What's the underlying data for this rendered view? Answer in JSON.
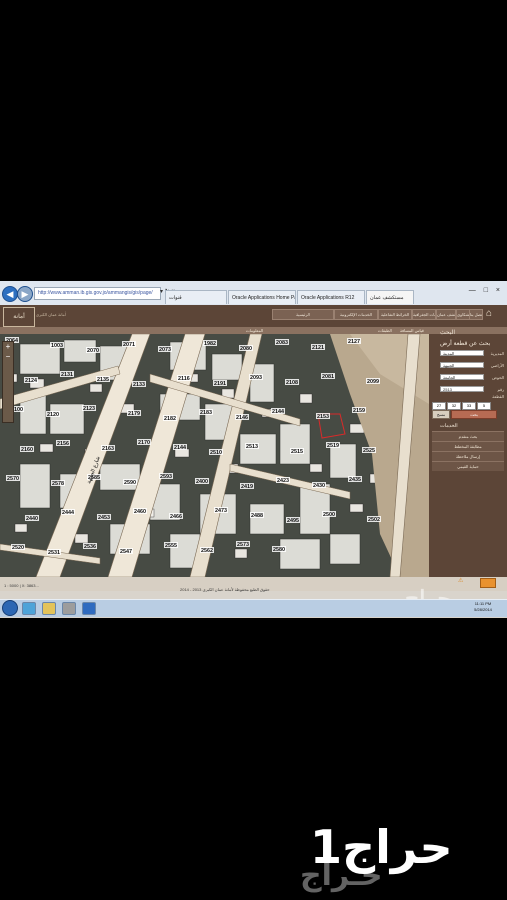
{
  "browser": {
    "address": "http://www.amman.ib.gis.gov.jo/ammangis/gis/page/",
    "address_controls": "▾ ↻ ×",
    "tabs": [
      "قنوات",
      "Oracle Applications Home Page",
      "Oracle Applications R12",
      "مستكشف عمان"
    ],
    "window_controls": "— □ ×",
    "toolbar_icons": "⌂ ☆ ⚙"
  },
  "site": {
    "logo_text": "أمانة",
    "subtitle": "أمانة عمان الكبرى",
    "menu": [
      "الرئيسية",
      "الخدمات الإلكترونية",
      "الخرائط التفاعلية",
      "المعلومات الجغرافية",
      "مستكشف عمان",
      "صندوق الشكاوى",
      "اتصل بنا"
    ],
    "subbar": [
      "المعلومات",
      "الطبقات",
      "قياس المسافة"
    ],
    "home_icon": "⌂"
  },
  "panel": {
    "title": "البحث",
    "subtitle": "بحث عن قطعة أرض",
    "fields": [
      {
        "label": "المديرية",
        "value": "المدينة"
      },
      {
        "label": "الأراضي",
        "value": "الجبيهة"
      },
      {
        "label": "الحوض",
        "value": "الجامعة"
      },
      {
        "label": "رقم القطعة",
        "value": "2513"
      }
    ],
    "coords": [
      "27",
      "32",
      "33",
      "5"
    ],
    "search_label": "بحث",
    "clear_label": "مسح",
    "services_title": "الخدمات",
    "services": [
      "بحث متقدم",
      "مطابقة المخطط",
      "إرسال ملاحظة",
      "حماية القيمي"
    ]
  },
  "zoom": {
    "plus": "+",
    "minus": "−"
  },
  "map": {
    "labels": [
      "2064",
      "1003",
      "2070",
      "2071",
      "2073",
      "1982",
      "2080",
      "2083",
      "2121",
      "2127",
      "2124",
      "2131",
      "2135",
      "2133",
      "2116",
      "2191",
      "2093",
      "2108",
      "2081",
      "2099",
      "2100",
      "2120",
      "2123",
      "2179",
      "2182",
      "2183",
      "2146",
      "2144",
      "2153",
      "2159",
      "2160",
      "2156",
      "2163",
      "2170",
      "2144",
      "2510",
      "2513",
      "2515",
      "2519",
      "2525",
      "2570",
      "2578",
      "2585",
      "2590",
      "2593",
      "2400",
      "2419",
      "2423",
      "2430",
      "2435",
      "2440",
      "2444",
      "2453",
      "2460",
      "2466",
      "2473",
      "2488",
      "2495",
      "2500",
      "2502",
      "2520",
      "2531",
      "2536",
      "2547",
      "2555",
      "2562",
      "2573",
      "2580"
    ],
    "street_label": "شارع الجبيهة"
  },
  "footer": {
    "left": "1 : 5000 | X: 3863...",
    "middle": "حقوق الطبع محفوظة لأمانة عمان الكبرى 2013 - 2014",
    "warn_icon": "⚠"
  },
  "taskbar": {
    "clock_time": "11:11 PM",
    "clock_date": "5/28/2014"
  },
  "watermark": "حراج",
  "brand": {
    "text": "حراج1",
    "shadow": "حـراج"
  }
}
